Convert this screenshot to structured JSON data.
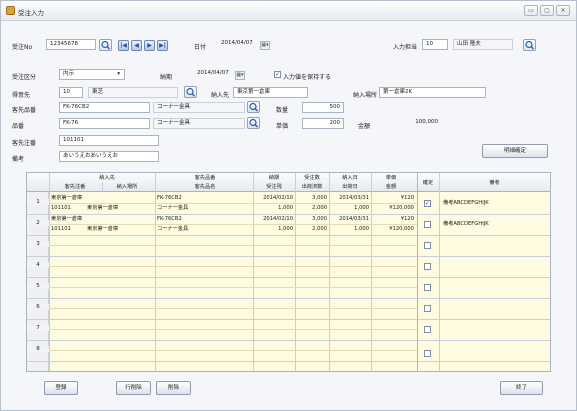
{
  "window": {
    "title": "受注入力",
    "minimize": "▭",
    "maximize": "▢",
    "close": "✕"
  },
  "header": {
    "order_no_label": "受注No",
    "order_no": "12345678",
    "date_label": "日付",
    "date": "2014/04/07",
    "entry_person_label": "入力担当",
    "entry_person_code": "10",
    "entry_person_name": "山田 隆夫"
  },
  "form": {
    "order_type_label": "受注区分",
    "order_type": "内示",
    "delivery_date_label": "納期",
    "delivery_date": "2014/04/07",
    "keep_input_label": "入力値を保持する",
    "keep_input_checked": true,
    "customer_label": "得意先",
    "customer_code": "10",
    "customer_name": "東芝",
    "delivery_dest_label": "納入先",
    "delivery_dest": "東京第一倉庫",
    "delivery_place_label": "納入場所",
    "delivery_place": "第一倉庫2K",
    "cust_part_label": "客先品番",
    "cust_part": "FK-76CB2",
    "cust_part_name": "コーナー金具",
    "qty_label": "数量",
    "qty": "500",
    "part_label": "品番",
    "part": "FK-76",
    "part_name": "コーナー金具",
    "unit_price_label": "単価",
    "unit_price": "200",
    "amount_label": "金額",
    "amount": "100,000",
    "cust_order_no_label": "客先注番",
    "cust_order_no": "101101",
    "remarks_label": "備考",
    "remarks": "あいうえおあいうえお",
    "confirm_button": "明細確定"
  },
  "grid": {
    "headers": {
      "delivery_dest": "納入先",
      "cust_order_no": "客先注番",
      "delivery_place": "納入場所",
      "cust_part": "客先品番",
      "cust_part_name": "客先品名",
      "delivery_date": "納期",
      "order_remain": "受注残",
      "order_qty": "受注数",
      "ship_qty": "出荷済数",
      "delivery_day": "納入日",
      "ship_day": "出荷日",
      "unit_price": "単価",
      "amount": "金額",
      "confirmed": "確定",
      "remarks": "備考"
    },
    "rows": [
      {
        "num": "1",
        "dest": "東京第一倉庫",
        "cust_order_no": "101101",
        "place": "東京第一倉庫",
        "cust_part": "FK-76CB2",
        "cust_part_name": "コーナー金具",
        "date": "2014/02/10",
        "remain": "1,000",
        "order_qty": "3,000",
        "ship_qty": "2,000",
        "delivery_day": "2014/03/31",
        "ship_day": "1,000",
        "price": "¥120",
        "amount": "¥120,000",
        "confirmed": true,
        "remarks": "備考ABCDEFGHIJK"
      },
      {
        "num": "2",
        "dest": "東京第一倉庫",
        "cust_order_no": "101101",
        "place": "東京第一倉庫",
        "cust_part": "FK-76CB2",
        "cust_part_name": "コーナー金具",
        "date": "2014/02/10",
        "remain": "1,000",
        "order_qty": "3,000",
        "ship_qty": "2,000",
        "delivery_day": "2014/03/31",
        "ship_day": "1,000",
        "price": "¥120",
        "amount": "¥120,000",
        "confirmed": false,
        "remarks": "備考ABCDEFGHIJK"
      },
      {
        "num": "3"
      },
      {
        "num": "4"
      },
      {
        "num": "5"
      },
      {
        "num": "6"
      },
      {
        "num": "7"
      },
      {
        "num": "8"
      }
    ]
  },
  "footer": {
    "register_button": "登録",
    "row_delete_button": "行削除",
    "delete_button": "削除",
    "exit_button": "終了"
  },
  "icons": {
    "search": "search-icon",
    "first": "first-record-icon",
    "prev": "prev-record-icon",
    "next": "next-record-icon",
    "last": "last-record-icon"
  },
  "colors": {
    "grid_background": "#fffbe0",
    "window_background": "#f4f6fa",
    "nav_accent": "#2a4f9a"
  }
}
